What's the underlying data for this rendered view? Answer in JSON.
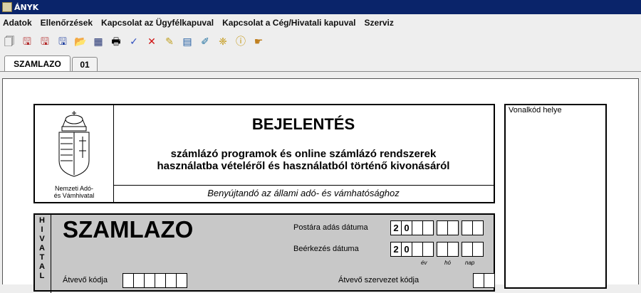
{
  "window": {
    "title": "ÁNYK"
  },
  "menu": [
    "Adatok",
    "Ellenőrzések",
    "Kapcsolat az Ügyfélkapuval",
    "Kapcsolat a Cég/Hivatali kapuval",
    "Szerviz"
  ],
  "toolbar": [
    "new-icon",
    "save-icon",
    "save-as-icon",
    "save-close-icon",
    "import-icon",
    "close-form-icon",
    "print-icon",
    "check-icon",
    "delete-icon",
    "edit-icon",
    "calculator-icon",
    "attachment-icon",
    "tools-icon",
    "info-icon",
    "pointer-icon"
  ],
  "tabs": [
    "SZAMLAZO",
    "01"
  ],
  "header": {
    "title": "BEJELENTÉS",
    "subtitle_line1": "számlázó programok és online számlázó rendszerek",
    "subtitle_line2": "használatba vételéről és használatból történő kivonásáról",
    "footer": "Benyújtandó az állami adó- és vámhatósághoz",
    "logo_text_line1": "Nemzeti Adó-",
    "logo_text_line2": "és Vámhivatal"
  },
  "barcode": {
    "label": "Vonalkód helye"
  },
  "office": {
    "vertical_label": [
      "H",
      "I",
      "V",
      "A",
      "T",
      "A",
      "L"
    ],
    "form_code": "SZAMLAZO",
    "postal_date_label": "Postára adás dátuma",
    "postal_date_prefix": [
      "2",
      "0"
    ],
    "arrival_date_label": "Beérkezés dátuma",
    "arrival_date_prefix": [
      "2",
      "0"
    ],
    "date_year": "év",
    "date_month": "hó",
    "date_day": "nap",
    "receiver_code_label": "Átvevő kódja",
    "receiver_org_label": "Átvevő szervezet kódja"
  },
  "colors": {
    "titlebar": "#0a246a",
    "panel": "#eeeeee",
    "office_fill": "#c8c8c8"
  }
}
